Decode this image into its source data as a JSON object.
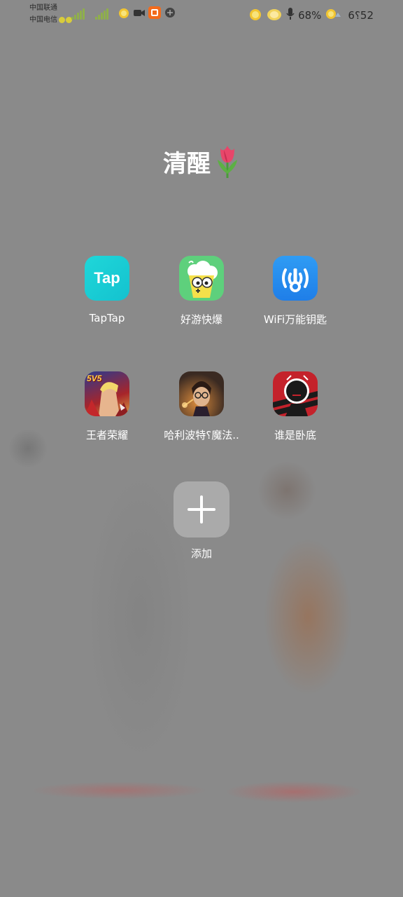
{
  "status_bar": {
    "carrier1": "中国联通",
    "carrier2": "中国电信",
    "battery": "68%",
    "time": "6⸮52",
    "icons": [
      "lemon-icon",
      "video-icon",
      "taobao-icon",
      "app-icon",
      "lemon-icon",
      "mic-icon",
      "battery-icon",
      "wifi-icon"
    ]
  },
  "folder": {
    "title": "清醒",
    "title_emoji": "tulip-icon"
  },
  "apps": [
    {
      "label": "TapTap",
      "icon": "taptap-icon",
      "badge_text": "Tap"
    },
    {
      "label": "好游快爆",
      "icon": "haoyoukuaibao-icon"
    },
    {
      "label": "WiFi万能钥匙",
      "icon": "wifi-master-key-icon"
    },
    {
      "label": "王者荣耀",
      "icon": "honor-of-kings-icon",
      "badge_text": "5V5"
    },
    {
      "label": "哈利波特⸮魔法..",
      "icon": "harry-potter-icon"
    },
    {
      "label": "谁是卧底",
      "icon": "who-is-spy-icon"
    }
  ],
  "add": {
    "label": "添加",
    "icon": "plus-icon"
  }
}
